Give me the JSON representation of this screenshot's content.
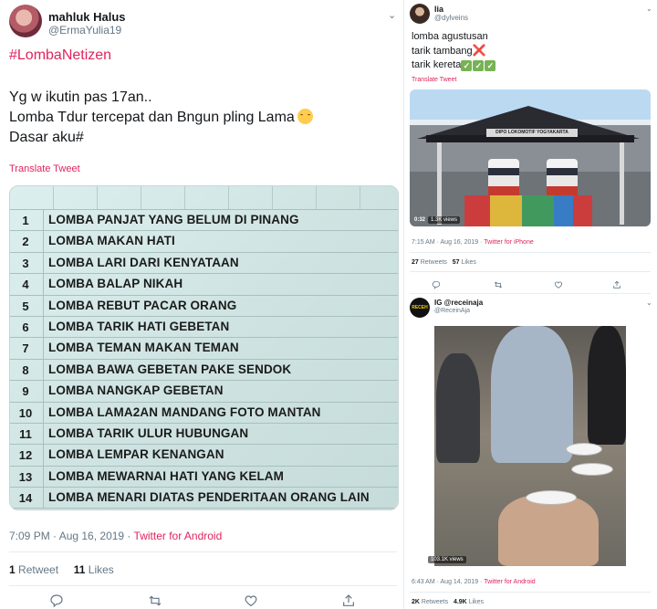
{
  "left_tweet": {
    "name": "mahluk Halus",
    "handle": "@ErmaYulia19",
    "hashtag": "#LombaNetizen",
    "lines": [
      "Yg w ikutin pas 17an..",
      "Lomba Tdur tercepat dan Bngun pling  Lama",
      "Dasar aku#"
    ],
    "translate": "Translate Tweet",
    "list": [
      {
        "num": "1",
        "text": "LOMBA PANJAT YANG BELUM DI PINANG"
      },
      {
        "num": "2",
        "text": "LOMBA MAKAN HATI"
      },
      {
        "num": "3",
        "text": "LOMBA LARI DARI KENYATAAN"
      },
      {
        "num": "4",
        "text": "LOMBA BALAP NIKAH"
      },
      {
        "num": "5",
        "text": "LOMBA REBUT PACAR ORANG"
      },
      {
        "num": "6",
        "text": "LOMBA TARIK HATI GEBETAN"
      },
      {
        "num": "7",
        "text": "LOMBA TEMAN MAKAN TEMAN"
      },
      {
        "num": "8",
        "text": "LOMBA BAWA GEBETAN PAKE SENDOK"
      },
      {
        "num": "9",
        "text": "LOMBA NANGKAP GEBETAN"
      },
      {
        "num": "10",
        "text": "LOMBA LAMA2AN MANDANG FOTO MANTAN"
      },
      {
        "num": "11",
        "text": "LOMBA TARIK ULUR HUBUNGAN"
      },
      {
        "num": "12",
        "text": "LOMBA LEMPAR KENANGAN"
      },
      {
        "num": "13",
        "text": "LOMBA MEWARNAI HATI YANG KELAM"
      },
      {
        "num": "14",
        "text": "LOMBA MENARI DIATAS PENDERITAAN ORANG LAIN"
      }
    ],
    "time": "7:09 PM · Aug 16, 2019 · ",
    "source": "Twitter for Android",
    "retweets": "1",
    "retweets_label": "Retweet",
    "likes": "11",
    "likes_label": "Likes",
    "icons": [
      "reply-icon",
      "retweet-icon",
      "like-icon",
      "share-icon"
    ]
  },
  "right_tweet_1": {
    "name": "lia",
    "handle": "@dylveins",
    "lines": [
      "lomba agustusan",
      "tarik tambang",
      "tarik kereta"
    ],
    "translate": "Translate Tweet",
    "video_sign": "DIPO LOKOMOTIF YOGYAKARTA",
    "video_time": "0:32",
    "video_views": "1.3K views",
    "time": "7:15 AM · Aug 16, 2019 · ",
    "source": "Twitter for iPhone",
    "retweets": "27",
    "retweets_label": "Retweets",
    "likes": "57",
    "likes_label": "Likes"
  },
  "right_tweet_2": {
    "name": "IG @receinaja",
    "handle": "@ReceinAja",
    "avatar_text": "RECEH",
    "video_time": "0:20",
    "video_views": "103.1K views",
    "time": "6:43 AM · Aug 14, 2019 · ",
    "source": "Twitter for Android",
    "retweets": "2K",
    "retweets_label": "Retweets",
    "likes": "4.9K",
    "likes_label": "Likes"
  },
  "colors": {
    "accent": "#e0245e",
    "muted": "#657786",
    "text": "#14171a"
  }
}
